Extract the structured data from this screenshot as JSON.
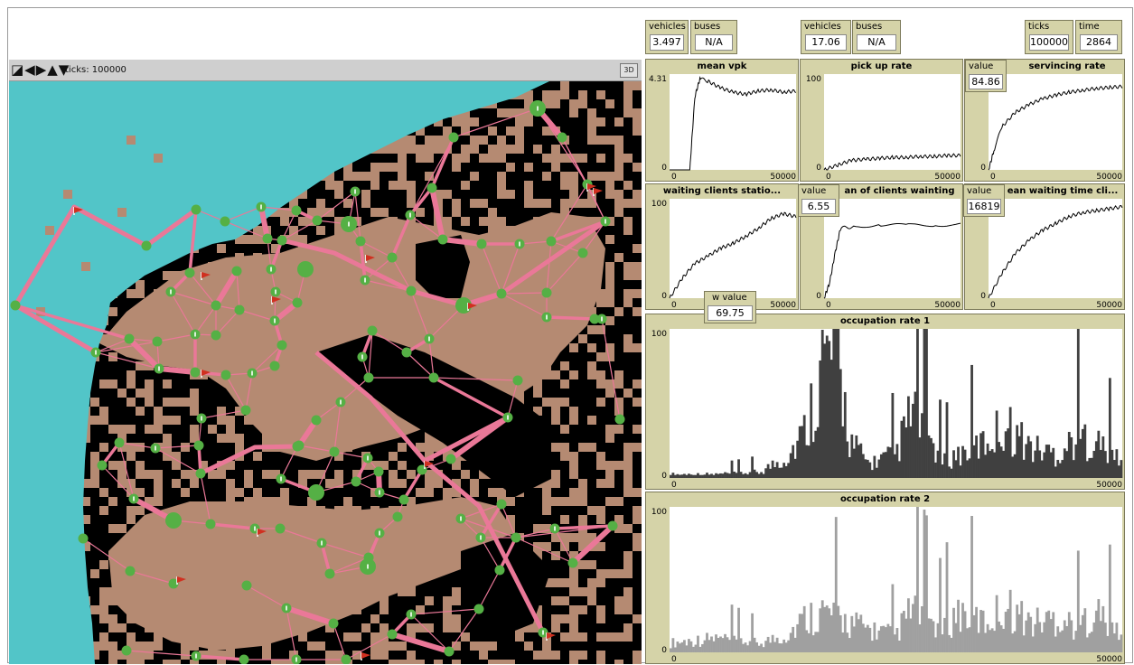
{
  "monitors": [
    {
      "label": "vehicles",
      "value": "3.497"
    },
    {
      "label": "buses",
      "value": "N/A"
    },
    {
      "label": "vehicles",
      "value": "17.06"
    },
    {
      "label": "buses",
      "value": "N/A"
    },
    {
      "label": "ticks",
      "value": "100000"
    },
    {
      "label": "time",
      "value": "2864"
    }
  ],
  "view": {
    "ticks_label": "ticks: 100000",
    "btn_3d": "3D",
    "icons": "◪◀▶▲▼"
  },
  "small_monitors": [
    {
      "label": "value",
      "value": "84.86"
    },
    {
      "label": "value",
      "value": "6.55"
    },
    {
      "label": "value",
      "value": "16819"
    },
    {
      "label": "w value",
      "value": "69.75"
    }
  ],
  "colors": {
    "background": "#d5d3a8",
    "water": "#52c5c8",
    "road": "#ea7898",
    "node": "#55b045",
    "land": "#b58a72",
    "flag": "#d03020"
  },
  "plots": [
    {
      "title": "mean vpk",
      "ymax_label": "4.31",
      "ymin_label": "0",
      "xmin_label": "0",
      "xmax_label": "50000",
      "color": "#000000",
      "type": "line"
    },
    {
      "title": "pick up rate",
      "ymax_label": "100",
      "ymin_label": "0",
      "xmin_label": "0",
      "xmax_label": "50000",
      "color": "#000000",
      "type": "line"
    },
    {
      "title": "servincing rate",
      "ymax_label": "",
      "ymin_label": "0",
      "xmin_label": "0",
      "xmax_label": "50000",
      "color": "#000000",
      "type": "line"
    },
    {
      "title": "waiting clients statio...",
      "ymax_label": "100",
      "ymin_label": "0",
      "xmin_label": "0",
      "xmax_label": "50000",
      "color": "#000000",
      "type": "line"
    },
    {
      "title": "an of clients wainting",
      "ymax_label": "100",
      "ymin_label": "0",
      "xmin_label": "0",
      "xmax_label": "50000",
      "color": "#000000",
      "type": "line"
    },
    {
      "title": "ean waiting time cli...",
      "ymax_label": "100",
      "ymin_label": "0",
      "xmin_label": "0",
      "xmax_label": "50000",
      "color": "#000000",
      "type": "line"
    },
    {
      "title": "occupation rate 1",
      "ymax_label": "100",
      "ymin_label": "0",
      "xmin_label": "0",
      "xmax_label": "50000",
      "color": "#404040",
      "type": "bar"
    },
    {
      "title": "occupation rate 2",
      "ymax_label": "100",
      "ymin_label": "0",
      "xmin_label": "0",
      "xmax_label": "50000",
      "color": "#a0a0a0",
      "type": "bar"
    }
  ],
  "chart_data": [
    {
      "type": "line",
      "title": "mean vpk",
      "x": [
        0,
        5000,
        8000,
        10000,
        12000,
        15000,
        20000,
        25000,
        30000,
        35000,
        40000,
        45000,
        50000
      ],
      "values": [
        0,
        0,
        0,
        3.3,
        4.1,
        4.0,
        3.7,
        3.5,
        3.4,
        3.55,
        3.6,
        3.5,
        3.55
      ],
      "xlim": [
        0,
        50000
      ],
      "ylim": [
        0,
        4.31
      ]
    },
    {
      "type": "line",
      "title": "pick up rate",
      "x": [
        0,
        5000,
        10000,
        15000,
        20000,
        25000,
        30000,
        35000,
        40000,
        45000,
        50000
      ],
      "values": [
        0,
        5,
        10,
        11,
        12,
        13,
        13,
        14,
        14,
        15,
        15
      ],
      "xlim": [
        0,
        50000
      ],
      "ylim": [
        0,
        100
      ]
    },
    {
      "type": "line",
      "title": "servincing rate",
      "x": [
        0,
        2000,
        5000,
        10000,
        15000,
        20000,
        25000,
        30000,
        35000,
        40000,
        45000,
        50000
      ],
      "values": [
        0,
        20,
        45,
        60,
        68,
        74,
        78,
        81,
        83,
        85,
        86,
        87
      ],
      "xlim": [
        0,
        50000
      ],
      "ylim": [
        0,
        100
      ]
    },
    {
      "type": "line",
      "title": "waiting clients statio...",
      "x": [
        0,
        5000,
        10000,
        15000,
        20000,
        25000,
        30000,
        35000,
        40000,
        45000,
        50000
      ],
      "values": [
        0,
        20,
        35,
        42,
        50,
        55,
        62,
        70,
        80,
        85,
        82
      ],
      "xlim": [
        0,
        50000
      ],
      "ylim": [
        0,
        100
      ]
    },
    {
      "type": "line",
      "title": "an of clients wainting",
      "x": [
        0,
        2000,
        4000,
        6000,
        10000,
        20000,
        30000,
        40000,
        50000
      ],
      "values": [
        0,
        15,
        45,
        70,
        72,
        74,
        73,
        74,
        74
      ],
      "xlim": [
        0,
        50000
      ],
      "ylim": [
        0,
        100
      ]
    },
    {
      "type": "line",
      "title": "ean waiting time cli...",
      "x": [
        0,
        5000,
        10000,
        15000,
        20000,
        25000,
        30000,
        35000,
        40000,
        45000,
        50000
      ],
      "values": [
        0,
        25,
        45,
        58,
        68,
        75,
        82,
        86,
        88,
        90,
        92
      ],
      "xlim": [
        0,
        50000
      ],
      "ylim": [
        0,
        100
      ]
    },
    {
      "type": "bar",
      "title": "occupation rate 1",
      "x": [
        0,
        5000,
        10000,
        13000,
        15000,
        17000,
        18500,
        20000,
        22000,
        25000,
        27000,
        30000,
        32000,
        35000,
        37000,
        40000,
        43000,
        45000,
        47000,
        50000
      ],
      "values": [
        3,
        3,
        5,
        18,
        40,
        100,
        100,
        30,
        12,
        20,
        60,
        15,
        20,
        30,
        45,
        25,
        20,
        35,
        30,
        15
      ],
      "xlim": [
        0,
        50000
      ],
      "ylim": [
        0,
        100
      ]
    },
    {
      "type": "bar",
      "title": "occupation rate 2",
      "x": [
        0,
        5000,
        10000,
        13000,
        15000,
        17000,
        20000,
        22000,
        25000,
        27000,
        30000,
        32000,
        35000,
        37000,
        40000,
        43000,
        45000,
        47000,
        50000
      ],
      "values": [
        8,
        12,
        8,
        15,
        30,
        35,
        25,
        20,
        15,
        40,
        20,
        35,
        25,
        40,
        25,
        30,
        22,
        35,
        15
      ],
      "xlim": [
        0,
        50000
      ],
      "ylim": [
        0,
        100
      ]
    }
  ]
}
